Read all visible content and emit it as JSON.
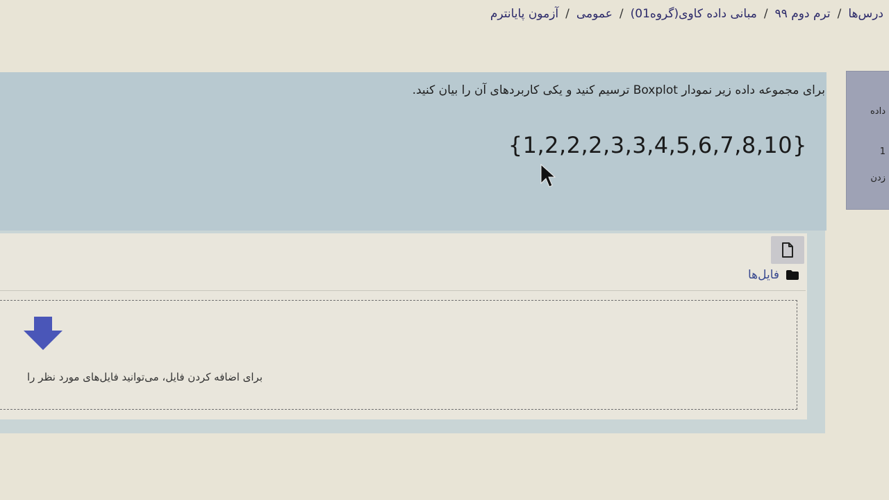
{
  "breadcrumb": {
    "items": [
      "درس‌ها",
      "ترم دوم ۹۹",
      "مبانی داده کاوی(گروه01)",
      "عمومی",
      "آزمون پایانترم"
    ],
    "separator": "/"
  },
  "question": {
    "text": "برای مجموعه داده زیر نمودار Boxplot ترسیم کنید و یکی کاربردهای آن را بیان کنید.",
    "dataset": "{1,2,2,2,3,3,4,5,6,7,8,10}"
  },
  "side_panel": {
    "lines": [
      "داده",
      "1",
      "زدن"
    ]
  },
  "answer": {
    "files_label": "فایل‌ها",
    "file_button_icon": "file-icon",
    "folder_icon": "folder-icon",
    "drop_hint": "برای اضافه کردن فایل، می‌توانید فایل‌های مورد نظر را"
  },
  "colors": {
    "question_bg": "#b8c9d0",
    "breadcrumb_link": "#2c2a6a",
    "files_link": "#3a4a90",
    "arrow": "#4a56b8"
  }
}
